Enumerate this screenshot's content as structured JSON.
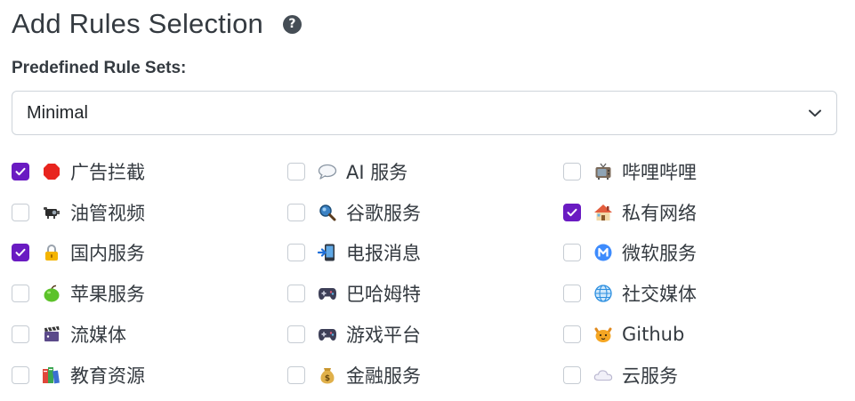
{
  "header": {
    "title": "Add Rules Selection",
    "help_icon": "question-circle-icon",
    "help_glyph": "?"
  },
  "predefined": {
    "label": "Predefined Rule Sets:",
    "selected": "Minimal"
  },
  "colors": {
    "checked": "#6a1bc2",
    "text": "#343a40"
  },
  "rules": [
    {
      "label": "广告拦截",
      "checked": true,
      "icon": "stop-sign-icon"
    },
    {
      "label": "AI 服务",
      "checked": false,
      "icon": "speech-bubble-icon"
    },
    {
      "label": "哔哩哔哩",
      "checked": false,
      "icon": "tv-icon"
    },
    {
      "label": "油管视频",
      "checked": false,
      "icon": "projector-icon"
    },
    {
      "label": "谷歌服务",
      "checked": false,
      "icon": "magnifier-icon"
    },
    {
      "label": "私有网络",
      "checked": true,
      "icon": "house-icon"
    },
    {
      "label": "国内服务",
      "checked": true,
      "icon": "lock-icon"
    },
    {
      "label": "电报消息",
      "checked": false,
      "icon": "mobile-arrow-icon"
    },
    {
      "label": "微软服务",
      "checked": false,
      "icon": "m-badge-icon"
    },
    {
      "label": "苹果服务",
      "checked": false,
      "icon": "green-apple-icon"
    },
    {
      "label": "巴哈姆特",
      "checked": false,
      "icon": "gamepad-icon"
    },
    {
      "label": "社交媒体",
      "checked": false,
      "icon": "globe-icon"
    },
    {
      "label": "流媒体",
      "checked": false,
      "icon": "clapper-icon"
    },
    {
      "label": "游戏平台",
      "checked": false,
      "icon": "gamepad-icon"
    },
    {
      "label": "Github",
      "checked": false,
      "icon": "cat-icon"
    },
    {
      "label": "教育资源",
      "checked": false,
      "icon": "books-icon"
    },
    {
      "label": "金融服务",
      "checked": false,
      "icon": "money-bag-icon"
    },
    {
      "label": "云服务",
      "checked": false,
      "icon": "cloud-icon"
    }
  ]
}
